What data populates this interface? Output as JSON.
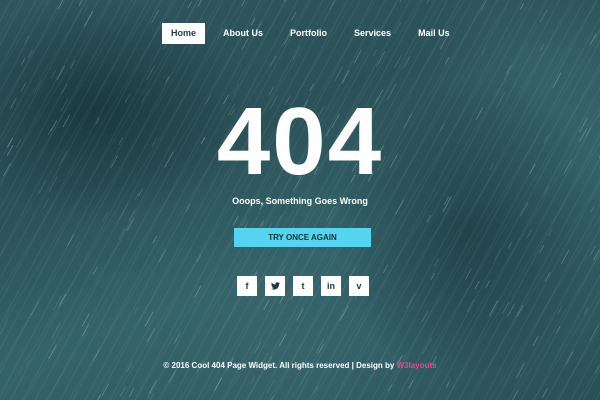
{
  "nav": {
    "items": [
      {
        "label": "Home",
        "active": true
      },
      {
        "label": "About Us",
        "active": false
      },
      {
        "label": "Portfolio",
        "active": false
      },
      {
        "label": "Services",
        "active": false
      },
      {
        "label": "Mail Us",
        "active": false
      }
    ]
  },
  "hero": {
    "code": "404",
    "message": "Ooops, Something Goes Wrong",
    "button_label": "TRY ONCE AGAIN"
  },
  "social": [
    {
      "glyph": "f",
      "icon": "facebook-icon"
    },
    {
      "glyph": "t",
      "icon": "twitter-icon"
    },
    {
      "glyph": "t",
      "icon": "tumblr-icon"
    },
    {
      "glyph": "in",
      "icon": "linkedin-icon"
    },
    {
      "glyph": "v",
      "icon": "vimeo-icon"
    }
  ],
  "footer": {
    "text": "© 2016 Cool 404 Page Widget. All rights reserved | Design by ",
    "link_text": "W3layouts"
  },
  "colors": {
    "accent_button": "#55d4f0",
    "link": "#e8488a",
    "background": "#2a4f56"
  }
}
